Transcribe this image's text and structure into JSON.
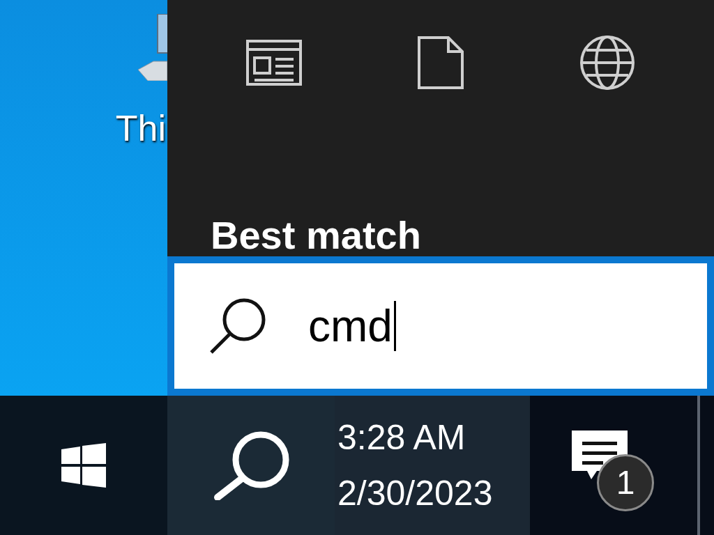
{
  "desktop": {
    "icon_label": "Thi"
  },
  "search_panel": {
    "filters": [
      {
        "kind": "apps"
      },
      {
        "kind": "documents"
      },
      {
        "kind": "web"
      }
    ],
    "section_title": "Best match",
    "search_field": {
      "value": "cmd"
    }
  },
  "taskbar": {
    "clock": {
      "time": "3:28 AM",
      "date": "2/30/2023"
    },
    "notifications": {
      "count": "1"
    }
  }
}
